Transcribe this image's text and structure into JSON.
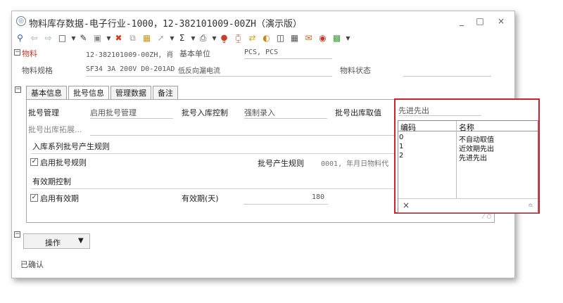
{
  "window": {
    "title": "物料库存数据-电子行业-1000，12-382101009-00ZH（演示版）",
    "minimize": "_",
    "maximize": "□",
    "close": "×"
  },
  "header": {
    "material_label": "物料",
    "material_code": "12-382101009-00ZH, 肖",
    "base_unit_label": "基本单位",
    "base_unit_value": "PCS, PCS",
    "spec_label": "物料规格",
    "spec_value": "SF34 3A 200V D0-201AD",
    "spec_desc": "低反向漏电流",
    "status_label": "物料状态"
  },
  "tabs": [
    "基本信息",
    "批号信息",
    "管理数据",
    "备注"
  ],
  "batch": {
    "mgmt_label": "批号管理",
    "mgmt_value": "启用批号管理",
    "in_ctrl_label": "批号入库控制",
    "in_ctrl_value": "强制录入",
    "out_label": "批号出库取值",
    "ext_label": "批号出库拓展...",
    "inbound_group": "入库系列批号产生规则",
    "enable_rule": "启用批号规则",
    "rule_label": "批号产生规则",
    "rule_value": "0001, 年月日物料代",
    "expiry_group": "有效期控制",
    "enable_expiry": "启用有效期",
    "expiry_label": "有效期(天)",
    "expiry_value": "180",
    "faint_number": "78"
  },
  "operate": {
    "label": "操作",
    "arrow": "▼"
  },
  "status_text": "已确认",
  "popup": {
    "field_value": "先进先出",
    "columns": [
      "编码",
      "名称"
    ],
    "rows": [
      {
        "code": "0",
        "name": "不自动取值"
      },
      {
        "code": "1",
        "name": "近效期先出"
      },
      {
        "code": "2",
        "name": "先进先出"
      }
    ],
    "close_icon": "×"
  },
  "colors": {
    "highlight": "#d0202a"
  }
}
